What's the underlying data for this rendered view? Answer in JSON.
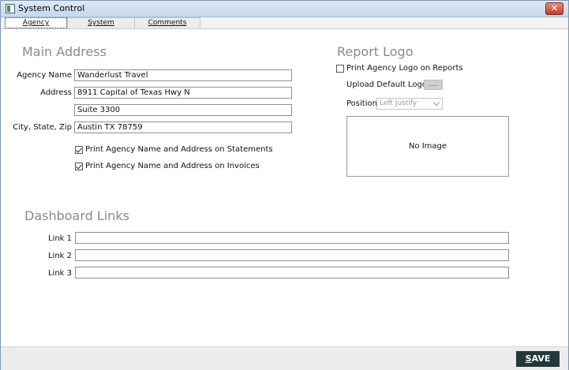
{
  "window": {
    "title": "System Control",
    "close_symbol": "✕"
  },
  "tabs": [
    {
      "label": "Agency",
      "active": true
    },
    {
      "label": "System",
      "active": false
    },
    {
      "label": "Comments",
      "active": false
    }
  ],
  "main_address": {
    "title": "Main Address",
    "agency_name_label": "Agency Name",
    "agency_name_value": "Wanderlust Travel",
    "address_label": "Address",
    "address_line1_value": "8911 Capital of Texas Hwy N",
    "address_line2_value": "Suite 3300",
    "city_state_zip_label": "City, State, Zip",
    "city_state_zip_value": "Austin TX 78759",
    "print_on_statements_label": "Print Agency Name and Address on Statements",
    "print_on_statements_checked": true,
    "print_on_invoices_label": "Print Agency Name and Address on Invoices",
    "print_on_invoices_checked": true
  },
  "report_logo": {
    "title": "Report Logo",
    "print_logo_label": "Print Agency Logo on Reports",
    "print_logo_checked": false,
    "upload_label": "Upload Default Logo",
    "upload_button_label": "....",
    "position_label": "Position",
    "position_value": "Left Justify",
    "preview_text": "No Image"
  },
  "dashboard_links": {
    "title": "Dashboard Links",
    "links": [
      {
        "label": "Link 1",
        "value": ""
      },
      {
        "label": "Link 2",
        "value": ""
      },
      {
        "label": "Link 3",
        "value": ""
      }
    ]
  },
  "footer": {
    "save_label": "SAVE",
    "save_underline": "S",
    "save_rest": "AVE"
  },
  "colors": {
    "save_button": "#243a3a",
    "section_title": "#8a8a8a",
    "close_button": "#c13d27"
  }
}
